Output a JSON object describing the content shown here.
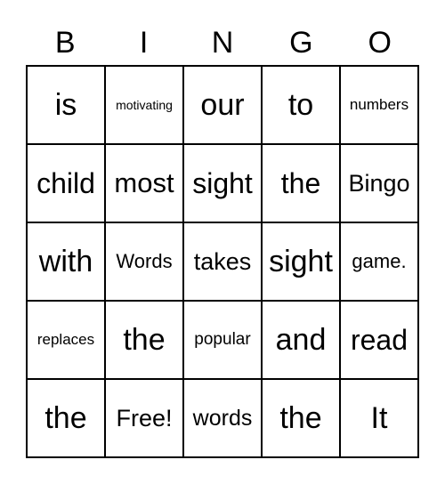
{
  "header": [
    "B",
    "I",
    "N",
    "G",
    "O"
  ],
  "cells": [
    [
      "is",
      "motivating",
      "our",
      "to",
      "numbers"
    ],
    [
      "child",
      "most",
      "sight",
      "the",
      "Bingo"
    ],
    [
      "with",
      "Words",
      "takes",
      "sight",
      "game."
    ],
    [
      "replaces",
      "the",
      "popular",
      "and",
      "read"
    ],
    [
      "the",
      "Free!",
      "words",
      "the",
      "It"
    ]
  ]
}
